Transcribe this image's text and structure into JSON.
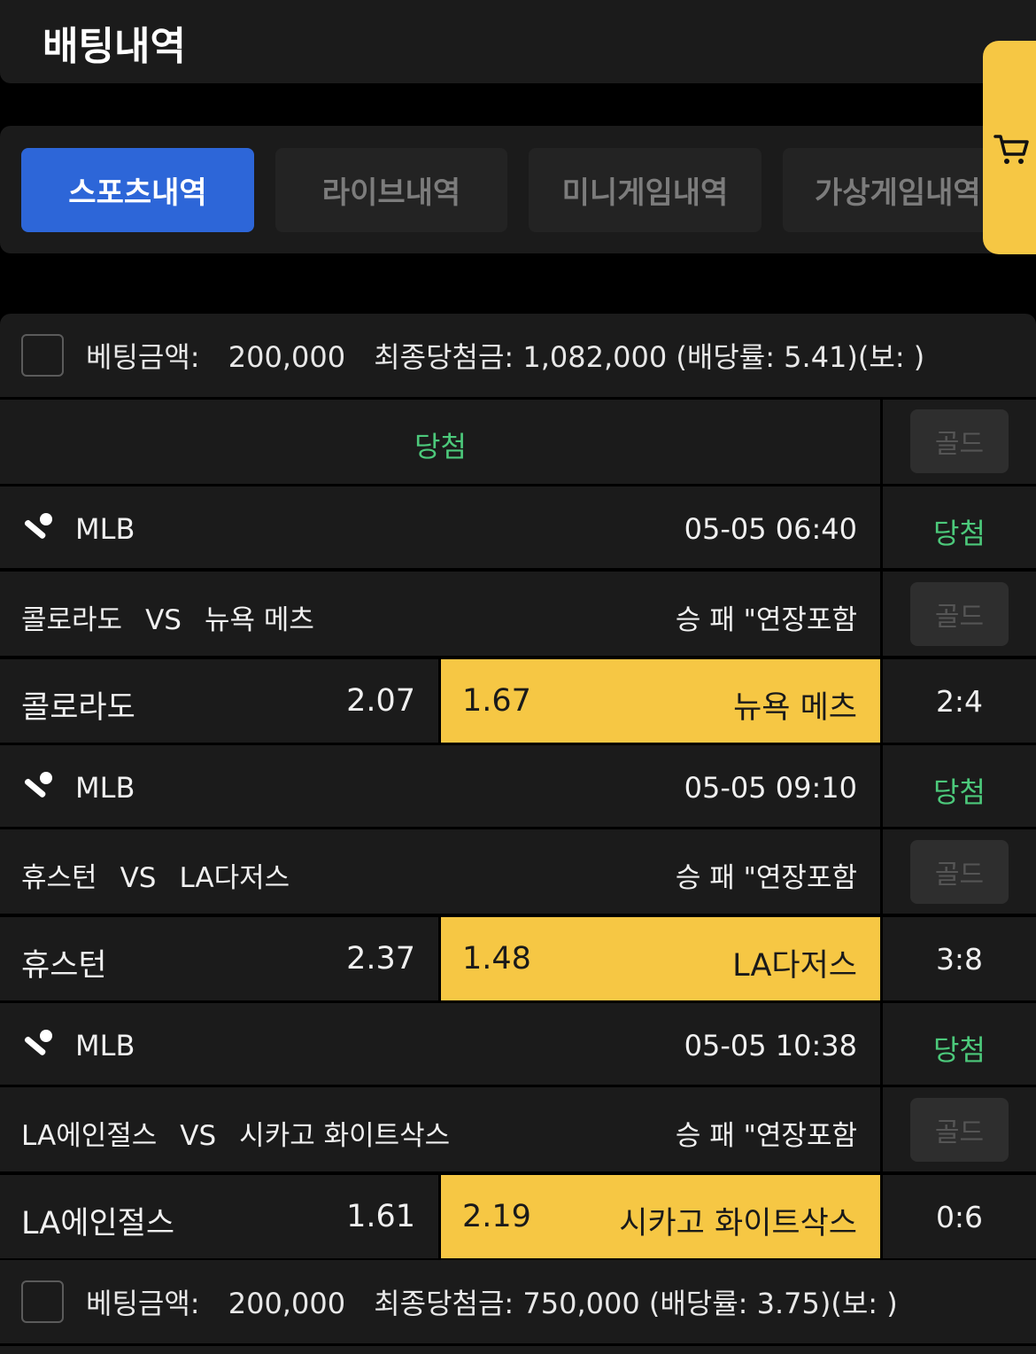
{
  "header": {
    "title": "배팅내역"
  },
  "tabs": [
    {
      "label": "스포츠내역",
      "active": true
    },
    {
      "label": "라이브내역",
      "active": false
    },
    {
      "label": "미니게임내역",
      "active": false
    },
    {
      "label": "가상게임내역",
      "active": false
    }
  ],
  "cart_icon": "cart-icon",
  "slips": [
    {
      "bet_label": "베팅금액:",
      "bet_amount": "200,000",
      "final_label": "최종당첨금:",
      "final_amount": "1,082,000",
      "rate_text": "(배당률: 5.41)(보: )",
      "status": "당첨",
      "gold_label": "골드",
      "games": [
        {
          "league": "MLB",
          "datetime": "05-05 06:40",
          "result": "당첨",
          "home": "콜로라도",
          "vs": "VS",
          "away": "뉴욕 메츠",
          "market": "승 패 \"연장포함",
          "gold_label": "골드",
          "home_odds": "2.07",
          "away_odds": "1.67",
          "pick_name": "뉴욕 메츠",
          "score": "2:4"
        },
        {
          "league": "MLB",
          "datetime": "05-05 09:10",
          "result": "당첨",
          "home": "휴스턴",
          "vs": "VS",
          "away": "LA다저스",
          "market": "승 패 \"연장포함",
          "gold_label": "골드",
          "home_odds": "2.37",
          "away_odds": "1.48",
          "pick_name": "LA다저스",
          "score": "3:8"
        },
        {
          "league": "MLB",
          "datetime": "05-05 10:38",
          "result": "당첨",
          "home": "LA에인절스",
          "vs": "VS",
          "away": "시카고 화이트삭스",
          "market": "승 패 \"연장포함",
          "gold_label": "골드",
          "home_odds": "1.61",
          "away_odds": "2.19",
          "pick_name": "시카고 화이트삭스",
          "score": "0:6"
        }
      ]
    },
    {
      "bet_label": "베팅금액:",
      "bet_amount": "200,000",
      "final_label": "최종당첨금:",
      "final_amount": "750,000",
      "rate_text": "(배당률: 3.75)(보: )"
    }
  ],
  "colors": {
    "accent_blue": "#2d66d8",
    "highlight_yellow": "#f6c744",
    "win_green": "#4cc97b",
    "panel": "#1b1b1b"
  }
}
